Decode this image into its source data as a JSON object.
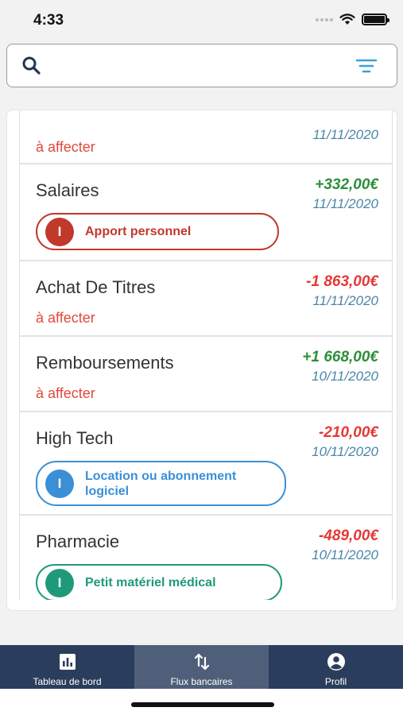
{
  "status_bar": {
    "time": "4:33"
  },
  "search": {
    "placeholder": "",
    "value": ""
  },
  "transactions": [
    {
      "label": "",
      "amount": "",
      "date": "11/11/2020",
      "affect": "à affecter"
    },
    {
      "label": "Salaires",
      "amount": "+332,00€",
      "date": "11/11/2020",
      "category": {
        "letter": "I",
        "name": "Apport personnel",
        "color": "#c0392b"
      }
    },
    {
      "label": "Achat De Titres",
      "amount": "-1 863,00€",
      "date": "11/11/2020",
      "affect": "à affecter"
    },
    {
      "label": "Remboursements",
      "amount": "+1 668,00€",
      "date": "10/11/2020",
      "affect": "à affecter"
    },
    {
      "label": "High Tech",
      "amount": "-210,00€",
      "date": "10/11/2020",
      "category": {
        "letter": "I",
        "name": "Location ou abonnement logiciel",
        "color": "#3a8fd6"
      }
    },
    {
      "label": "Pharmacie",
      "amount": "-489,00€",
      "date": "10/11/2020",
      "category": {
        "letter": "I",
        "name": "Petit matériel médical",
        "color": "#1e9a7a"
      }
    }
  ],
  "tabs": [
    {
      "label": "Tableau de bord",
      "icon": "chart-icon",
      "active": false
    },
    {
      "label": "Flux bancaires",
      "icon": "transfer-arrows-icon",
      "active": true
    },
    {
      "label": "Profil",
      "icon": "profile-icon",
      "active": false
    }
  ],
  "colors": {
    "positive": "#2c8f3a",
    "negative": "#e53935",
    "date": "#4a86a8",
    "affect": "#e04a3a",
    "tab_bar": "#2b3d5c",
    "tab_active": "#4f5f7a"
  }
}
